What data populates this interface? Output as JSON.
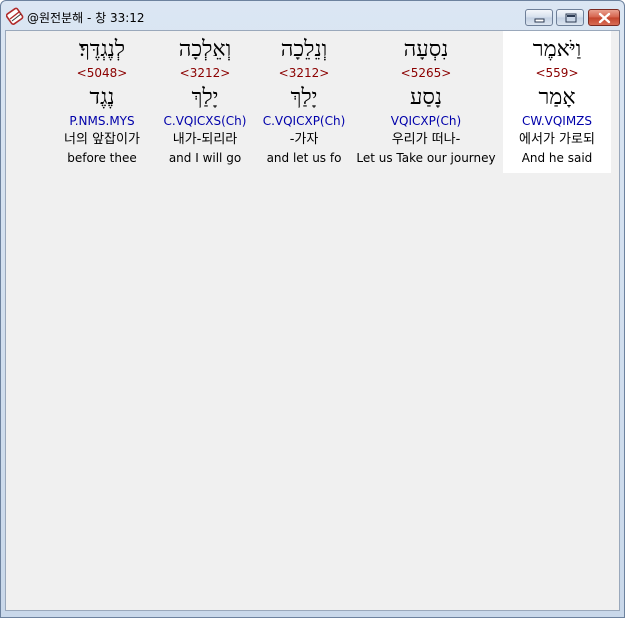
{
  "window": {
    "title": "@원전분해 - 창 33:12",
    "icon": "bible-app-icon"
  },
  "words": [
    {
      "hebrew": "וַיֹּאמֶר",
      "strong": "<559>",
      "root": "אָמַר",
      "parse": "CW.VQIMZS",
      "korean": "에서가 가로되",
      "english": "And he said",
      "selected": true
    },
    {
      "hebrew": "נִסְעָה",
      "strong": "<5265>",
      "root": "נָסַע",
      "parse": "VQICXP(Ch)",
      "korean": "우리가 떠나-",
      "english": "Let us Take our journey",
      "selected": false
    },
    {
      "hebrew": "וְנֵלֵכָה",
      "strong": "<3212>",
      "root": "יָלַךְ",
      "parse": "C.VQICXP(Ch)",
      "korean": "-가자",
      "english": "and let us fo",
      "selected": false
    },
    {
      "hebrew": "וְאֵלְכָה",
      "strong": "<3212>",
      "root": "יָלַךְ",
      "parse": "C.VQICXS(Ch)",
      "korean": "내가-되리라",
      "english": "and I will go",
      "selected": false
    },
    {
      "hebrew": "לְנֶגְדֶּךָ׃",
      "strong": "<5048>",
      "root": "נֶגֶד",
      "parse": "P.NMS.MYS",
      "korean": "너의 앞잡이가",
      "english": "before thee",
      "selected": false
    }
  ]
}
